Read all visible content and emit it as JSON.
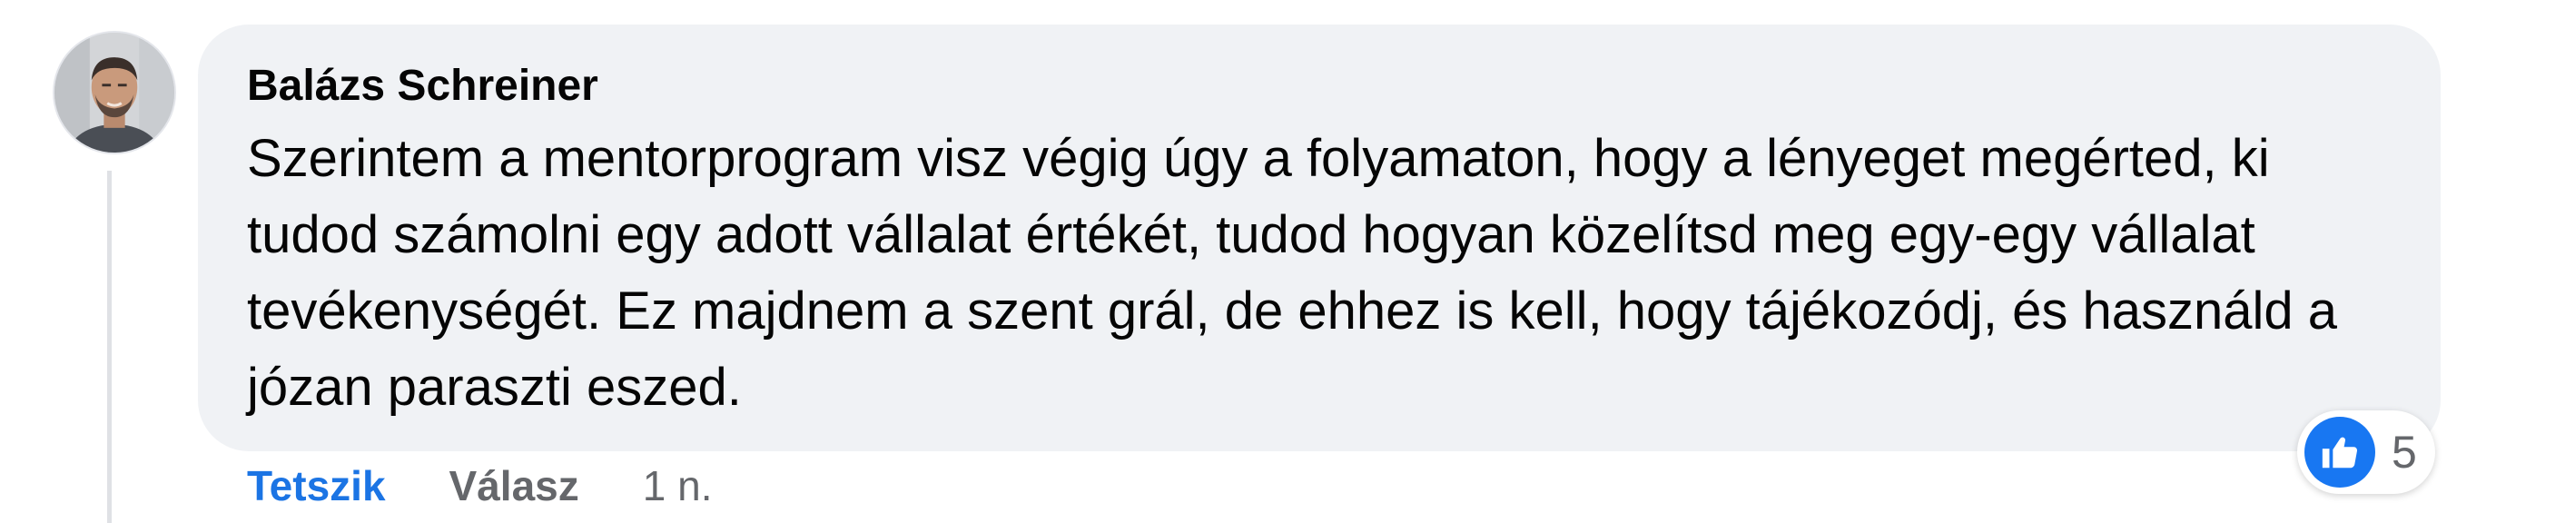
{
  "comment": {
    "author": "Balázs Schreiner",
    "text": "Szerintem a mentorprogram visz végig úgy a folyamaton, hogy a lényeget megérted, ki tudod számolni egy adott vállalat értékét, tudod hogyan közelítsd meg egy-egy vállalat tevékenységét. Ez majdnem a szent grál, de ehhez is kell, hogy tájékozódj, és használd a józan paraszti eszed.",
    "avatar_icon": "profile-photo"
  },
  "actions": {
    "like_label": "Tetszik",
    "reply_label": "Válasz",
    "timestamp": "1 n."
  },
  "reactions": {
    "icon": "thumbs-up-icon",
    "count": "5"
  },
  "colors": {
    "bubble": "#f0f2f5",
    "like_blue": "#1b74e4",
    "secondary_text": "#65676b",
    "reaction_blue": "#1877f2"
  }
}
